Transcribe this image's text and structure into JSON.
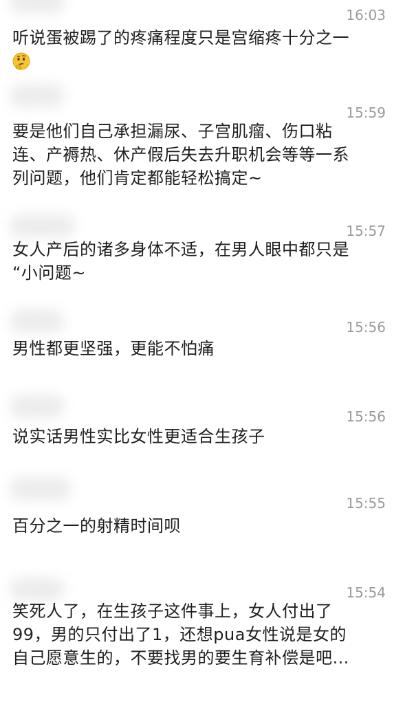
{
  "comments": [
    {
      "time": "16:03",
      "lines": [
        "听说蛋被踢了的疼痛程度只是宫缩疼十分之一"
      ],
      "emoji": "thinking-face"
    },
    {
      "time": "15:59",
      "lines": [
        "要是他们自己承担漏尿、子宫肌瘤、伤口粘",
        "连、产褥热、休产假后失去升职机会等等一系",
        "列问题，他们肯定都能轻松搞定~"
      ]
    },
    {
      "time": "15:57",
      "lines": [
        "女人产后的诸多身体不适，在男人眼中都只是",
        "“小问题~"
      ]
    },
    {
      "time": "15:56",
      "lines": [
        "男性都更坚强，更能不怕痛"
      ]
    },
    {
      "time": "15:56",
      "lines": [
        "说实话男性实比女性更适合生孩子"
      ]
    },
    {
      "time": "15:55",
      "lines": [
        "百分之一的射精时间呗"
      ]
    },
    {
      "time": "15:54",
      "lines": [
        "笑死人了，在生孩子这件事上，女人付出了",
        "99，男的只付出了1，还想pua女性说是女的",
        "自己愿意生的，不要找男的要生育补偿是吧…"
      ]
    }
  ]
}
